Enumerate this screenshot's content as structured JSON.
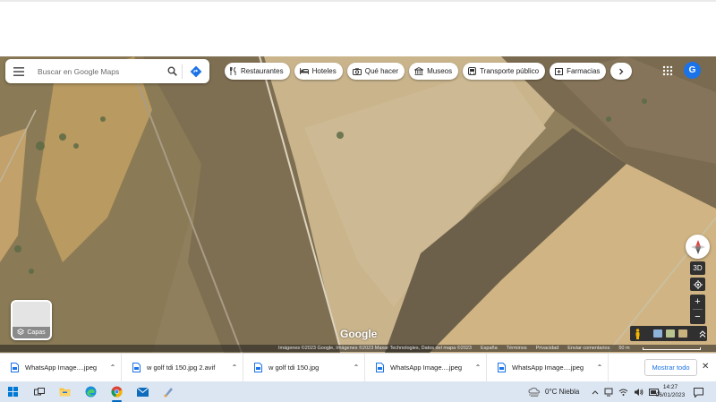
{
  "search": {
    "placeholder": "Buscar en Google Maps"
  },
  "chips": [
    {
      "label": "Restaurantes",
      "icon": "fork-knife-icon"
    },
    {
      "label": "Hoteles",
      "icon": "bed-icon"
    },
    {
      "label": "Qué hacer",
      "icon": "camera-icon"
    },
    {
      "label": "Museos",
      "icon": "museum-icon"
    },
    {
      "label": "Transporte público",
      "icon": "bus-icon"
    },
    {
      "label": "Farmacias",
      "icon": "pharmacy-icon"
    }
  ],
  "account": {
    "initial": "G"
  },
  "layers": {
    "label": "Capas"
  },
  "map": {
    "logo": "Google",
    "controls": {
      "tilt_label": "3D",
      "zoom_in": "+",
      "zoom_out": "−"
    },
    "attribution": {
      "imagery": "Imágenes ©2023 Google, Imágenes ©2023 Maxar Technologies, Datos del mapa ©2023",
      "country": "España",
      "terms": "Términos",
      "privacy": "Privacidad",
      "feedback": "Enviar comentarios",
      "scale": "50 m"
    }
  },
  "downloads": {
    "items": [
      {
        "name": "WhatsApp Image....jpeg"
      },
      {
        "name": "w golf  tdi 150.jpg 2.avif"
      },
      {
        "name": "w golf  tdi 150.jpg"
      },
      {
        "name": "WhatsApp Image....jpeg"
      },
      {
        "name": "WhatsApp Image....jpeg"
      }
    ],
    "show_all": "Mostrar todo"
  },
  "taskbar": {
    "weather": "0°C  Niebla",
    "time": "14:27",
    "date": "06/01/2023"
  },
  "colors": {
    "accent": "#1a73e8",
    "taskbar": "#dce6f2"
  }
}
